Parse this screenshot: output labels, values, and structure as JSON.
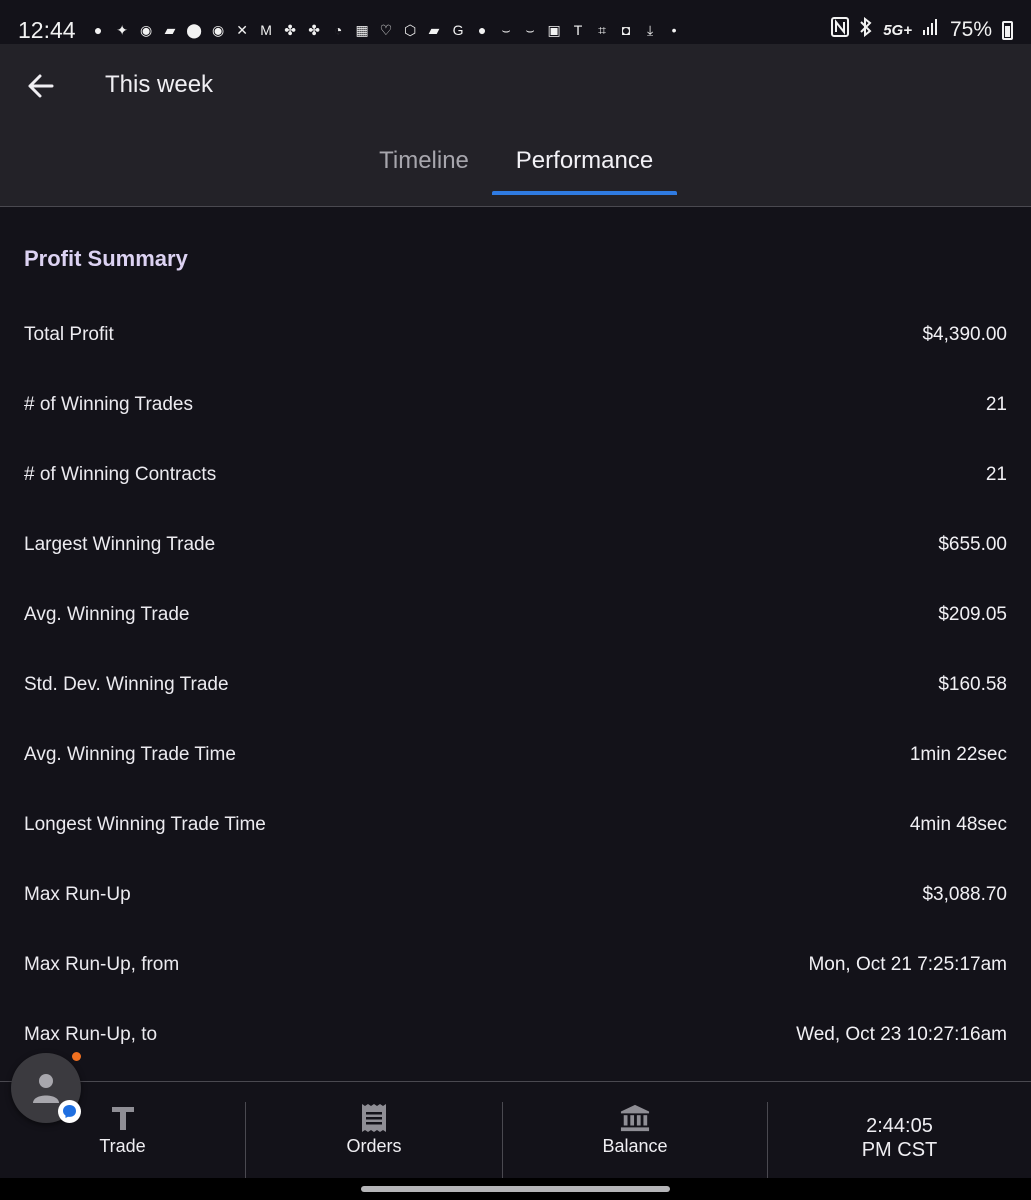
{
  "status_bar": {
    "time": "12:44",
    "network": "5G+",
    "battery": "75%",
    "notification_icons": [
      "chat-icon",
      "sparkle-icon",
      "amex-icon",
      "card-icon",
      "adt-icon",
      "amex-icon",
      "x-icon",
      "gmail-icon",
      "pinwheel-icon",
      "pinwheel-icon",
      "clock-icon",
      "grid-icon",
      "heart-icon",
      "shield-icon",
      "card-icon",
      "google-icon",
      "chat-icon",
      "amazon-icon",
      "amazon-icon",
      "image-icon",
      "tesla-icon",
      "scan-icon",
      "bag-icon",
      "download-icon",
      "dot-icon"
    ],
    "right_icons": [
      "nfc-icon",
      "bluetooth-icon",
      "signal-icon",
      "battery-icon"
    ]
  },
  "header": {
    "title": "This week"
  },
  "tabs": [
    {
      "label": "Timeline",
      "active": false
    },
    {
      "label": "Performance",
      "active": true
    }
  ],
  "section": {
    "title": "Profit Summary"
  },
  "rows": [
    {
      "label": "Total Profit",
      "value": "$4,390.00"
    },
    {
      "label": "# of Winning Trades",
      "value": "21"
    },
    {
      "label": "# of Winning Contracts",
      "value": "21"
    },
    {
      "label": "Largest Winning Trade",
      "value": "$655.00"
    },
    {
      "label": "Avg. Winning Trade",
      "value": "$209.05"
    },
    {
      "label": "Std. Dev. Winning Trade",
      "value": "$160.58"
    },
    {
      "label": "Avg. Winning Trade Time",
      "value": "1min 22sec"
    },
    {
      "label": "Longest Winning Trade Time",
      "value": "4min 48sec"
    },
    {
      "label": "Max Run-Up",
      "value": "$3,088.70"
    },
    {
      "label": "Max Run-Up, from",
      "value": "Mon, Oct 21 7:25:17am"
    },
    {
      "label": "Max Run-Up, to",
      "value": "Wed, Oct 23 10:27:16am"
    }
  ],
  "bottom_nav": {
    "items": [
      {
        "label": "Trade",
        "icon": "t-icon"
      },
      {
        "label": "Orders",
        "icon": "receipt-icon"
      },
      {
        "label": "Balance",
        "icon": "bank-icon"
      }
    ],
    "clock_line1": "2:44:05",
    "clock_line2": "PM CST"
  },
  "colors": {
    "background": "#131219",
    "app_bar": "#232228",
    "accent": "#2f7be2",
    "section_title": "#dcd2f2",
    "notification_dot": "#f07020"
  }
}
